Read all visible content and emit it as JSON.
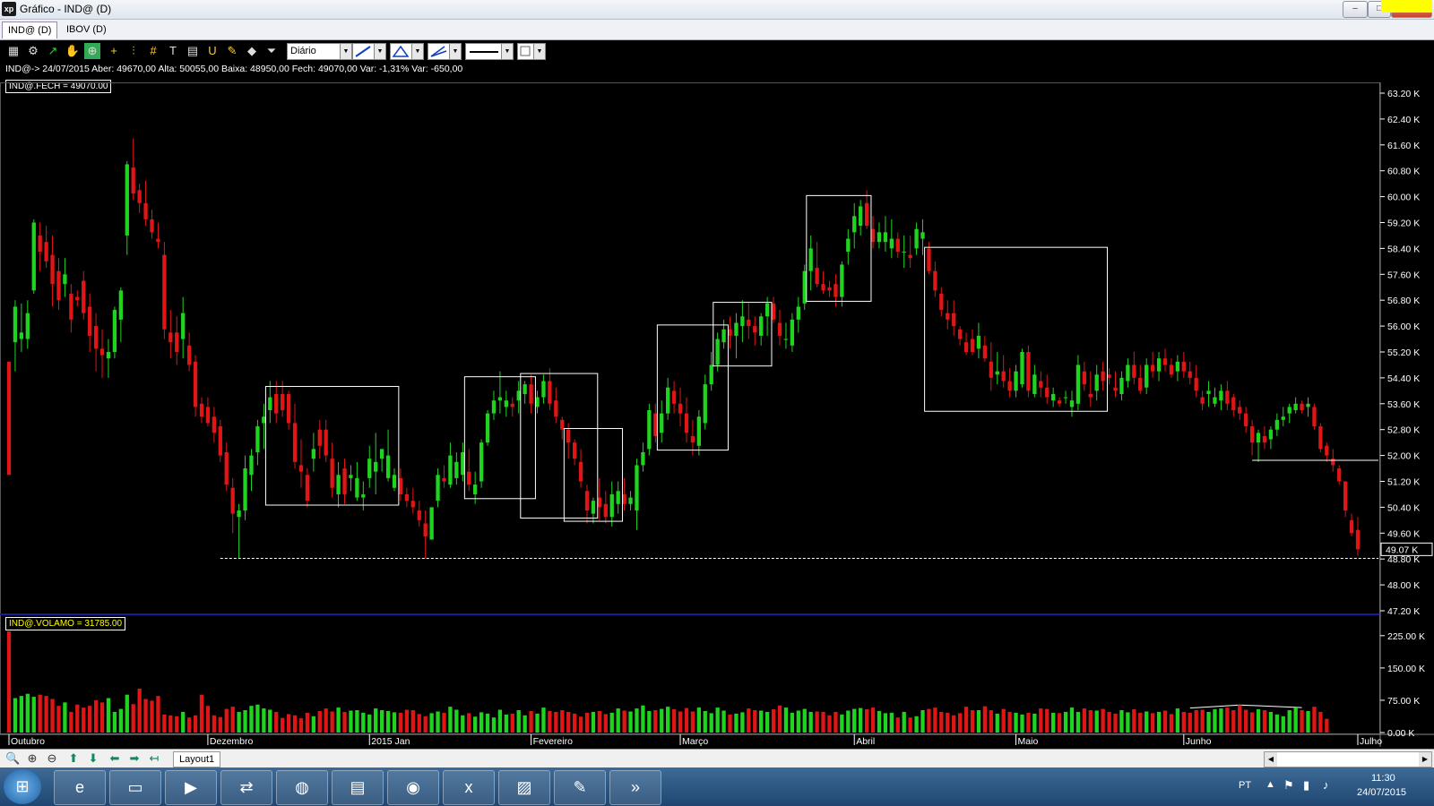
{
  "window": {
    "title": "Gráfico - IND@ (D)",
    "app_icon": "xp",
    "controls": {
      "minimize": "–",
      "maximize": "□",
      "close": "✕"
    }
  },
  "tabs": [
    {
      "label": "IND@ (D)"
    },
    {
      "label": "IBOV (D)"
    }
  ],
  "toolbar": {
    "period": "Diário"
  },
  "info_line": "IND@-> 24/07/2015 Aber: 49670,00 Alta: 50055,00 Baixa: 48950,00 Fech: 49070,00 Var: -1,31% Var: -650,00",
  "price_legend": "IND@.FECH = 49070.00",
  "volume_legend": "IND@.VOLAMO = 31785.00",
  "chart_data": {
    "type": "candlestick",
    "symbol": "IND@",
    "price_axis_ticks": [
      "63.20 K",
      "62.40 K",
      "61.60 K",
      "60.80 K",
      "60.00 K",
      "59.20 K",
      "58.40 K",
      "57.60 K",
      "56.80 K",
      "56.00 K",
      "55.20 K",
      "54.40 K",
      "53.60 K",
      "52.80 K",
      "52.00 K",
      "51.20 K",
      "50.40 K",
      "49.60 K",
      "48.80 K",
      "48.00 K",
      "47.20 K"
    ],
    "price_range_k": [
      47.2,
      63.2
    ],
    "last_price_label": "49.07 K",
    "volume_axis_ticks": [
      "225.00 K",
      "150.00 K",
      "75.00 K",
      "0.00 K"
    ],
    "last_volume_label": "31.79 K",
    "months": [
      "Outubro",
      "Dezembro",
      "2015 Jan",
      "Fevereiro",
      "Março",
      "Abril",
      "Maio",
      "Junho",
      "Julho"
    ],
    "colors": {
      "up": "#1fd41f",
      "down": "#e01515",
      "background": "#000000",
      "annotation": "#ffffff"
    },
    "candles_k": [
      [
        54.9,
        54.9,
        51.4,
        51.4
      ],
      [
        55.5,
        56.8,
        54.6,
        56.6
      ],
      [
        55.6,
        56.7,
        55.2,
        55.8
      ],
      [
        55.6,
        56.8,
        55.3,
        56.4
      ],
      [
        57.1,
        59.3,
        57.0,
        59.2
      ],
      [
        58.8,
        59.2,
        57.7,
        58.3
      ],
      [
        58.6,
        59.1,
        57.8,
        58.0
      ],
      [
        58.2,
        58.8,
        56.6,
        57.3
      ],
      [
        57.7,
        58.1,
        56.5,
        56.8
      ],
      [
        57.3,
        58.1,
        56.9,
        57.6
      ],
      [
        57.0,
        57.3,
        55.8,
        56.2
      ],
      [
        56.9,
        57.1,
        56.6,
        56.8
      ],
      [
        57.4,
        57.7,
        56.2,
        56.4
      ],
      [
        56.6,
        57.0,
        55.2,
        55.7
      ],
      [
        56.0,
        56.4,
        54.6,
        55.3
      ],
      [
        55.3,
        55.9,
        54.4,
        55.1
      ],
      [
        55.0,
        55.6,
        54.4,
        55.2
      ],
      [
        55.2,
        56.6,
        55.0,
        56.5
      ],
      [
        56.2,
        57.2,
        55.5,
        57.1
      ],
      [
        58.8,
        61.1,
        58.2,
        61.0
      ],
      [
        60.9,
        61.8,
        59.9,
        60.1
      ],
      [
        60.2,
        60.4,
        59.5,
        59.8
      ],
      [
        59.8,
        60.5,
        59.1,
        59.3
      ],
      [
        59.3,
        59.6,
        58.7,
        58.9
      ],
      [
        58.7,
        59.2,
        58.4,
        58.6
      ],
      [
        58.2,
        58.6,
        55.6,
        55.9
      ],
      [
        55.8,
        56.5,
        55.0,
        55.5
      ],
      [
        55.8,
        56.3,
        54.8,
        55.2
      ],
      [
        55.6,
        56.9,
        55.0,
        56.4
      ],
      [
        55.4,
        55.8,
        54.6,
        54.8
      ],
      [
        54.9,
        55.1,
        53.2,
        53.5
      ],
      [
        53.6,
        53.8,
        53.0,
        53.2
      ],
      [
        53.5,
        53.8,
        52.9,
        53.0
      ],
      [
        53.2,
        53.5,
        52.4,
        52.7
      ],
      [
        52.9,
        53.1,
        51.8,
        52.0
      ],
      [
        52.1,
        52.4,
        50.9,
        51.1
      ],
      [
        51.0,
        51.3,
        49.6,
        50.2
      ],
      [
        50.1,
        50.5,
        48.8,
        50.3
      ],
      [
        50.3,
        52.0,
        50.0,
        51.6
      ],
      [
        51.4,
        52.2,
        50.9,
        52.0
      ],
      [
        52.1,
        53.1,
        51.7,
        52.9
      ],
      [
        53.0,
        53.6,
        52.2,
        53.2
      ],
      [
        53.4,
        54.3,
        53.0,
        53.8
      ],
      [
        53.9,
        54.3,
        53.0,
        53.3
      ],
      [
        53.9,
        54.3,
        53.2,
        53.4
      ],
      [
        53.9,
        54.0,
        52.8,
        53.0
      ],
      [
        53.0,
        53.6,
        51.6,
        51.8
      ],
      [
        51.7,
        52.5,
        51.0,
        51.5
      ],
      [
        51.4,
        51.6,
        50.4,
        50.6
      ],
      [
        51.9,
        52.7,
        51.5,
        52.2
      ],
      [
        52.8,
        53.1,
        51.9,
        52.3
      ],
      [
        52.8,
        53.1,
        51.8,
        52.0
      ],
      [
        51.9,
        52.4,
        50.7,
        51.0
      ],
      [
        50.8,
        51.8,
        50.4,
        51.4
      ],
      [
        51.6,
        51.9,
        50.5,
        50.8
      ],
      [
        51.3,
        51.7,
        50.9,
        51.4
      ],
      [
        50.7,
        51.8,
        50.6,
        51.3
      ],
      [
        50.7,
        51.2,
        50.3,
        50.8
      ],
      [
        51.3,
        52.3,
        51.0,
        51.9
      ],
      [
        51.5,
        52.7,
        50.8,
        51.8
      ],
      [
        51.9,
        52.2,
        51.5,
        52.2
      ],
      [
        51.3,
        52.8,
        51.2,
        52.0
      ],
      [
        51.0,
        51.6,
        50.9,
        51.4
      ],
      [
        51.3,
        51.6,
        50.6,
        50.8
      ],
      [
        50.8,
        51.0,
        50.4,
        50.6
      ],
      [
        50.6,
        51.0,
        50.2,
        50.4
      ],
      [
        50.3,
        50.6,
        49.8,
        50.0
      ],
      [
        49.9,
        50.3,
        48.8,
        49.5
      ],
      [
        49.4,
        50.3,
        49.4,
        50.4
      ],
      [
        50.6,
        51.6,
        50.4,
        51.4
      ],
      [
        51.3,
        51.7,
        51.0,
        51.2
      ],
      [
        51.1,
        52.4,
        51.0,
        52.0
      ],
      [
        51.3,
        52.1,
        51.1,
        51.8
      ],
      [
        51.4,
        52.4,
        51.2,
        52.1
      ],
      [
        51.5,
        52.2,
        50.9,
        51.1
      ],
      [
        50.8,
        51.5,
        50.5,
        51.1
      ],
      [
        51.2,
        52.5,
        51.0,
        52.4
      ],
      [
        52.4,
        53.4,
        52.3,
        53.3
      ],
      [
        53.3,
        54.0,
        53.1,
        53.7
      ],
      [
        53.7,
        54.6,
        53.3,
        53.8
      ],
      [
        53.5,
        54.0,
        53.2,
        53.7
      ],
      [
        53.6,
        53.8,
        53.2,
        53.5
      ],
      [
        53.7,
        54.3,
        53.3,
        54.0
      ],
      [
        53.9,
        54.3,
        53.6,
        54.2
      ],
      [
        54.2,
        54.5,
        53.3,
        53.6
      ],
      [
        53.5,
        54.0,
        53.3,
        53.8
      ],
      [
        53.8,
        54.5,
        53.6,
        54.3
      ],
      [
        54.3,
        54.7,
        53.4,
        53.6
      ],
      [
        53.7,
        54.1,
        53.0,
        53.2
      ],
      [
        53.1,
        53.2,
        52.5,
        52.8
      ],
      [
        52.8,
        53.0,
        51.9,
        52.4
      ],
      [
        52.4,
        52.5,
        51.7,
        51.9
      ],
      [
        51.8,
        52.2,
        51.0,
        51.2
      ],
      [
        50.9,
        51.1,
        49.9,
        50.3
      ],
      [
        50.2,
        50.7,
        49.9,
        50.6
      ],
      [
        50.7,
        51.3,
        50.0,
        50.4
      ],
      [
        50.5,
        50.9,
        49.9,
        50.1
      ],
      [
        50.1,
        51.2,
        49.8,
        50.8
      ],
      [
        50.5,
        51.2,
        50.2,
        50.9
      ],
      [
        50.8,
        51.3,
        50.3,
        50.5
      ],
      [
        50.5,
        50.9,
        50.3,
        50.7
      ],
      [
        50.3,
        51.9,
        49.7,
        51.7
      ],
      [
        51.7,
        52.4,
        51.5,
        52.1
      ],
      [
        52.2,
        53.6,
        52.0,
        53.4
      ],
      [
        53.3,
        53.6,
        52.4,
        52.6
      ],
      [
        52.7,
        53.7,
        52.4,
        53.3
      ],
      [
        53.3,
        54.4,
        53.1,
        54.1
      ],
      [
        54.0,
        54.3,
        53.3,
        53.6
      ],
      [
        53.6,
        54.1,
        52.9,
        53.3
      ],
      [
        53.3,
        53.8,
        52.4,
        52.7
      ],
      [
        52.6,
        53.1,
        52.0,
        52.4
      ],
      [
        52.3,
        53.4,
        52.0,
        53.2
      ],
      [
        53.0,
        54.5,
        52.8,
        54.2
      ],
      [
        54.2,
        55.2,
        54.0,
        54.8
      ],
      [
        54.8,
        55.8,
        54.6,
        55.6
      ],
      [
        55.5,
        56.2,
        55.3,
        55.9
      ],
      [
        55.9,
        56.3,
        55.3,
        55.7
      ],
      [
        55.7,
        56.4,
        55.0,
        56.1
      ],
      [
        56.0,
        56.8,
        55.5,
        56.3
      ],
      [
        56.2,
        56.7,
        55.6,
        56.0
      ],
      [
        56.0,
        56.3,
        55.4,
        55.8
      ],
      [
        55.7,
        56.4,
        55.4,
        56.3
      ],
      [
        56.3,
        56.9,
        55.7,
        56.7
      ],
      [
        56.7,
        56.9,
        56.1,
        56.2
      ],
      [
        56.1,
        56.5,
        55.4,
        55.7
      ],
      [
        55.6,
        56.1,
        55.3,
        55.6
      ],
      [
        55.4,
        56.4,
        55.2,
        56.2
      ],
      [
        56.2,
        56.9,
        55.8,
        56.6
      ],
      [
        56.7,
        57.9,
        56.5,
        57.7
      ],
      [
        57.7,
        58.8,
        57.1,
        58.4
      ],
      [
        57.8,
        58.6,
        57.2,
        57.3
      ],
      [
        57.3,
        57.7,
        57.0,
        57.1
      ],
      [
        57.2,
        57.4,
        56.9,
        57.1
      ],
      [
        57.3,
        57.6,
        56.6,
        56.9
      ],
      [
        56.9,
        58.0,
        56.6,
        57.9
      ],
      [
        58.3,
        59.0,
        57.9,
        58.7
      ],
      [
        58.9,
        59.8,
        58.4,
        59.4
      ],
      [
        59.1,
        59.9,
        58.8,
        59.7
      ],
      [
        59.8,
        60.2,
        59.0,
        59.1
      ],
      [
        59.0,
        59.4,
        58.4,
        58.6
      ],
      [
        58.6,
        59.2,
        58.4,
        58.9
      ],
      [
        58.6,
        59.4,
        58.3,
        58.9
      ],
      [
        58.4,
        59.3,
        58.1,
        58.7
      ],
      [
        58.7,
        58.9,
        58.1,
        58.3
      ],
      [
        58.3,
        58.8,
        57.8,
        58.3
      ],
      [
        58.2,
        58.8,
        57.8,
        58.1
      ],
      [
        58.4,
        59.2,
        58.2,
        59.0
      ],
      [
        58.7,
        59.3,
        58.2,
        58.9
      ],
      [
        58.4,
        58.6,
        57.6,
        57.7
      ],
      [
        57.7,
        58.0,
        56.9,
        57.1
      ],
      [
        57.0,
        57.2,
        56.3,
        56.5
      ],
      [
        56.4,
        56.8,
        55.9,
        56.2
      ],
      [
        56.4,
        56.8,
        55.7,
        56.0
      ],
      [
        55.9,
        56.0,
        55.4,
        55.6
      ],
      [
        55.5,
        55.8,
        55.1,
        55.2
      ],
      [
        55.6,
        55.9,
        55.1,
        55.2
      ],
      [
        55.3,
        56.1,
        55.0,
        55.7
      ],
      [
        55.4,
        55.7,
        54.9,
        55.0
      ],
      [
        54.9,
        55.5,
        54.0,
        54.4
      ],
      [
        54.5,
        55.2,
        54.2,
        54.6
      ],
      [
        54.6,
        55.1,
        54.1,
        54.3
      ],
      [
        54.3,
        54.7,
        53.8,
        54.0
      ],
      [
        54.0,
        54.8,
        53.8,
        54.6
      ],
      [
        54.2,
        55.3,
        54.1,
        55.2
      ],
      [
        55.2,
        55.4,
        53.8,
        54.0
      ],
      [
        53.9,
        54.8,
        53.8,
        54.5
      ],
      [
        54.3,
        54.6,
        53.8,
        54.1
      ],
      [
        54.1,
        54.5,
        53.6,
        53.8
      ],
      [
        53.7,
        54.1,
        53.5,
        53.9
      ],
      [
        53.7,
        53.8,
        53.5,
        53.6
      ],
      [
        53.8,
        54.0,
        53.6,
        53.8
      ],
      [
        53.5,
        54.0,
        53.2,
        53.7
      ],
      [
        53.6,
        55.1,
        53.4,
        54.8
      ],
      [
        54.6,
        54.9,
        54.0,
        54.2
      ],
      [
        53.9,
        54.6,
        53.5,
        53.8
      ],
      [
        54.0,
        54.8,
        53.7,
        54.5
      ],
      [
        54.6,
        54.9,
        54.0,
        54.3
      ],
      [
        54.5,
        54.7,
        54.2,
        54.4
      ],
      [
        54.1,
        54.6,
        53.8,
        54.0
      ],
      [
        53.9,
        54.6,
        53.7,
        54.4
      ],
      [
        54.3,
        55.0,
        54.1,
        54.8
      ],
      [
        54.8,
        55.2,
        54.2,
        54.4
      ],
      [
        54.4,
        54.8,
        53.9,
        54.0
      ],
      [
        54.1,
        55.0,
        53.9,
        54.8
      ],
      [
        54.8,
        55.2,
        54.4,
        54.6
      ],
      [
        54.6,
        55.2,
        54.3,
        55.0
      ],
      [
        55.0,
        55.3,
        54.6,
        54.8
      ],
      [
        54.8,
        55.0,
        54.4,
        54.5
      ],
      [
        54.6,
        55.1,
        54.3,
        54.9
      ],
      [
        54.9,
        55.2,
        54.4,
        54.6
      ],
      [
        54.6,
        54.9,
        54.2,
        54.4
      ],
      [
        54.4,
        54.8,
        53.8,
        54.0
      ],
      [
        53.8,
        54.0,
        53.4,
        53.6
      ],
      [
        53.9,
        54.3,
        53.5,
        54.0
      ],
      [
        53.6,
        54.1,
        53.5,
        53.8
      ],
      [
        53.7,
        54.2,
        53.4,
        54.0
      ],
      [
        54.0,
        54.3,
        53.4,
        53.6
      ],
      [
        53.8,
        53.9,
        53.2,
        53.4
      ],
      [
        53.5,
        53.7,
        53.1,
        53.3
      ],
      [
        53.3,
        53.5,
        52.7,
        52.9
      ],
      [
        52.9,
        53.1,
        52.0,
        52.4
      ],
      [
        52.4,
        52.8,
        51.8,
        52.7
      ],
      [
        52.6,
        52.9,
        52.2,
        52.4
      ],
      [
        52.5,
        52.9,
        52.2,
        52.8
      ],
      [
        52.8,
        53.3,
        52.6,
        53.1
      ],
      [
        53.1,
        53.5,
        52.9,
        53.2
      ],
      [
        53.3,
        53.6,
        53.0,
        53.5
      ],
      [
        53.4,
        53.8,
        53.3,
        53.6
      ],
      [
        53.6,
        53.7,
        53.3,
        53.4
      ],
      [
        53.5,
        53.8,
        53.2,
        53.6
      ],
      [
        53.5,
        53.6,
        52.8,
        52.9
      ],
      [
        52.9,
        53.0,
        52.1,
        52.2
      ],
      [
        52.3,
        52.4,
        51.8,
        52.0
      ],
      [
        51.9,
        52.2,
        51.5,
        51.7
      ],
      [
        51.6,
        51.7,
        51.1,
        51.2
      ],
      [
        51.2,
        51.2,
        50.1,
        50.3
      ],
      [
        50.0,
        50.2,
        49.5,
        49.6
      ],
      [
        49.7,
        50.1,
        48.9,
        49.1
      ]
    ],
    "volumes_k": [
      235,
      80,
      85,
      90,
      83,
      88,
      85,
      78,
      62,
      70,
      48,
      65,
      58,
      62,
      75,
      70,
      80,
      48,
      55,
      88,
      66,
      102,
      78,
      74,
      85,
      42,
      40,
      38,
      48,
      35,
      40,
      88,
      62,
      40,
      36,
      55,
      60,
      48,
      52,
      62,
      65,
      56,
      53,
      48,
      34,
      43,
      40,
      33,
      46,
      38,
      50,
      56,
      49,
      58,
      48,
      51,
      52,
      46,
      42,
      56,
      52,
      50,
      47,
      46,
      53,
      52,
      43,
      38,
      45,
      49,
      46,
      60,
      53,
      40,
      45,
      37,
      47,
      44,
      35,
      53,
      42,
      44,
      52,
      40,
      50,
      44,
      58,
      50,
      48,
      52,
      48,
      44,
      37,
      46,
      48,
      50,
      43,
      46,
      56,
      51,
      49,
      56,
      63,
      50,
      52,
      55,
      60,
      54,
      49,
      57,
      49,
      58,
      50,
      45,
      58,
      51,
      42,
      44,
      47,
      56,
      52,
      51,
      48,
      54,
      63,
      58,
      46,
      51,
      55,
      48,
      49,
      48,
      40,
      48,
      42,
      51,
      55,
      57,
      54,
      58,
      50,
      45,
      46,
      35,
      48,
      35,
      38,
      52,
      55,
      58,
      48,
      46,
      40,
      45,
      60,
      52,
      52,
      61,
      52,
      44,
      55,
      48,
      46,
      42,
      46,
      44,
      56,
      55,
      46,
      45,
      48,
      58,
      48,
      56,
      52,
      51,
      55,
      48,
      44,
      52,
      47,
      54,
      46,
      49,
      45,
      48,
      51,
      43,
      56,
      48,
      46,
      52,
      53,
      48,
      54,
      56,
      58,
      52,
      64,
      53,
      47,
      54,
      52,
      48,
      42,
      38,
      52,
      58,
      52,
      50,
      60,
      48,
      32
    ],
    "annotations": [
      "consolidation rectangles",
      "support line near 48.80 K",
      "support line near 51.80 K"
    ]
  },
  "bottom": {
    "layout_tab": "Layout1"
  },
  "taskbar": {
    "language": "PT",
    "time": "11:30",
    "date": "24/07/2015"
  }
}
